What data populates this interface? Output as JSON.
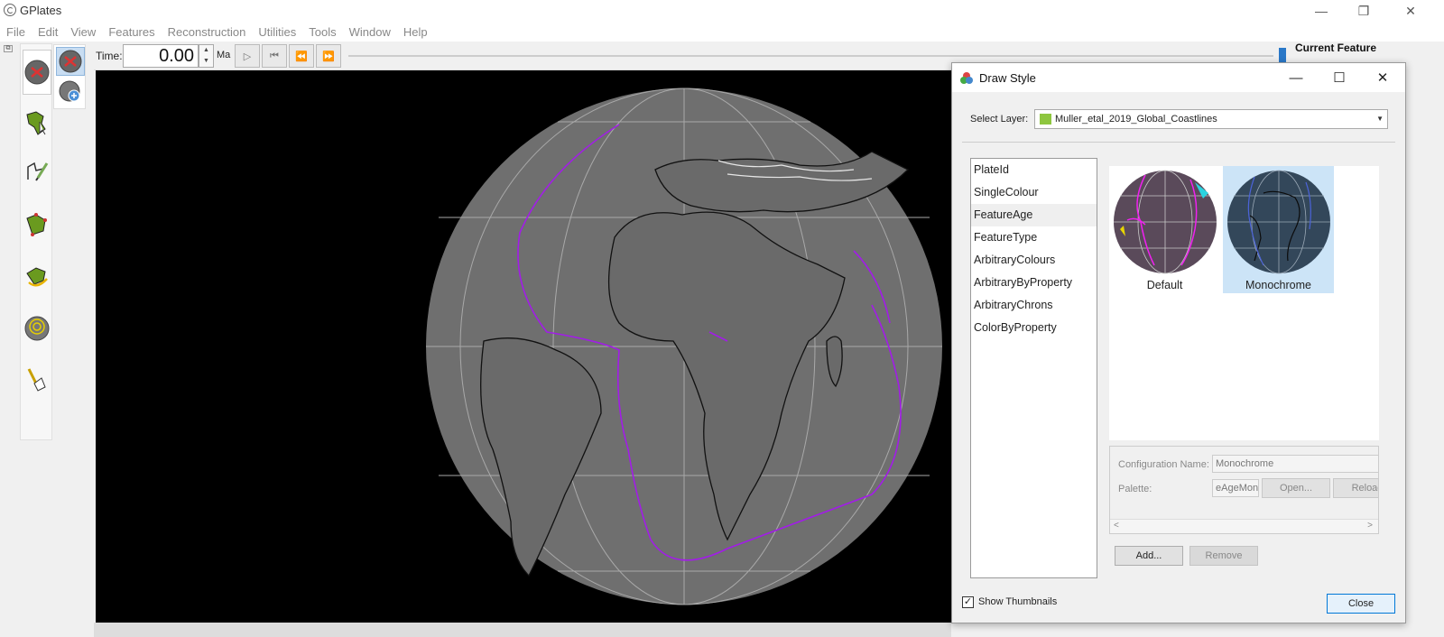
{
  "app": {
    "title": "GPlates"
  },
  "window_controls": {
    "minimize": "—",
    "restore": "❐",
    "close": "✕"
  },
  "menu": [
    "File",
    "Edit",
    "View",
    "Features",
    "Reconstruction",
    "Utilities",
    "Tools",
    "Window",
    "Help"
  ],
  "tools": [
    "drag-globe-icon",
    "choose-feature-icon",
    "digitise-geometry-icon",
    "move-vertex-icon",
    "pole-manipulation-icon",
    "small-circle-icon",
    "measure-distance-icon"
  ],
  "time_toolbar": {
    "label": "Time:",
    "value": "0.00",
    "unit": "Ma"
  },
  "right_panel": {
    "heading": "Current Feature"
  },
  "dialog": {
    "title": "Draw Style",
    "select_layer_label": "Select Layer:",
    "selected_layer": "Muller_etal_2019_Global_Coastlines",
    "layer_color": "#8ec63f",
    "styles": [
      "PlateId",
      "SingleColour",
      "FeatureAge",
      "FeatureType",
      "ArbitraryColours",
      "ArbitraryByProperty",
      "ArbitraryChrons",
      "ColorByProperty"
    ],
    "selected_style": "FeatureAge",
    "thumbnails": [
      {
        "caption": "Default",
        "selected": false
      },
      {
        "caption": "Monochrome",
        "selected": true
      }
    ],
    "config": {
      "name_label": "Configuration Name:",
      "name_value": "Monochrome",
      "palette_label": "Palette:",
      "palette_value": "eAgeMono",
      "open_button": "Open...",
      "reload_button": "Reload"
    },
    "add_button": "Add...",
    "remove_button": "Remove",
    "show_thumbnails_label": "Show Thumbnails",
    "show_thumbnails_checked": true,
    "close_button": "Close"
  }
}
